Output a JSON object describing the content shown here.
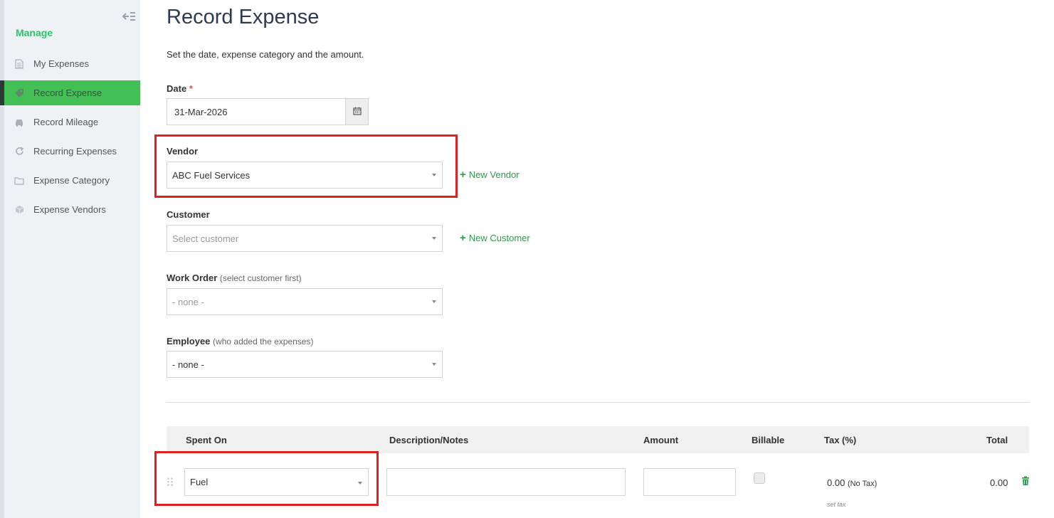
{
  "sidebar": {
    "heading": "Manage",
    "items": [
      {
        "label": "My Expenses",
        "icon": "document-icon"
      },
      {
        "label": "Record Expense",
        "icon": "tag-icon",
        "active": true
      },
      {
        "label": "Record Mileage",
        "icon": "car-icon"
      },
      {
        "label": "Recurring Expenses",
        "icon": "refresh-icon"
      },
      {
        "label": "Expense Category",
        "icon": "folder-icon"
      },
      {
        "label": "Expense Vendors",
        "icon": "box-icon"
      }
    ]
  },
  "page": {
    "title": "Record Expense",
    "subtitle": "Set the date, expense category and the amount."
  },
  "form": {
    "date": {
      "label": "Date",
      "required_mark": "*",
      "value": "31-Mar-2026"
    },
    "vendor": {
      "label": "Vendor",
      "value": "ABC Fuel Services",
      "add_label": "New Vendor"
    },
    "customer": {
      "label": "Customer",
      "placeholder": "Select customer",
      "add_label": "New Customer"
    },
    "work_order": {
      "label": "Work Order",
      "hint": "(select customer first)",
      "value": "- none -"
    },
    "employee": {
      "label": "Employee",
      "hint": "(who added the expenses)",
      "value": "- none -"
    }
  },
  "table": {
    "headers": [
      "Spent On",
      "Description/Notes",
      "Amount",
      "Billable",
      "Tax (%)",
      "Total"
    ],
    "row": {
      "spent_on": "Fuel",
      "description": "",
      "amount": "",
      "billable": false,
      "tax_value": "0.00",
      "tax_note": "(No Tax)",
      "set_tax": "set tax",
      "total": "0.00"
    }
  },
  "colors": {
    "accent_green": "#42bf55",
    "link_green": "#2d9a4c",
    "highlight_red": "#dd2020",
    "title_navy": "#2d3a4f"
  }
}
